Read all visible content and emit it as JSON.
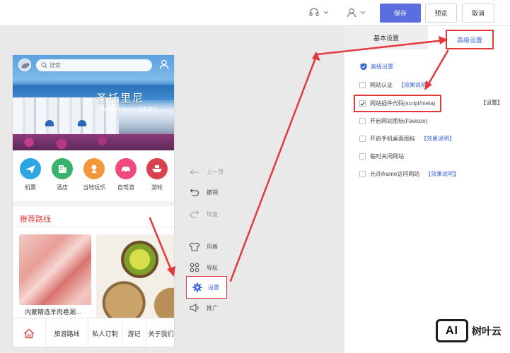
{
  "topbar": {
    "save_label": "保存",
    "preview_label": "预览",
    "cancel_label": "取消",
    "accent": "#5a6ee0"
  },
  "phone": {
    "search_placeholder": "搜索",
    "banner_title": "圣托里尼",
    "banner_subtitle": "Santorini Beach 花季旅行",
    "quick_icons": [
      {
        "label": "机票",
        "icon": "plane-icon",
        "color": "#2da6e6"
      },
      {
        "label": "酒店",
        "icon": "hotel-icon",
        "color": "#39b36b"
      },
      {
        "label": "当地玩乐",
        "icon": "fun-icon",
        "color": "#f4973c"
      },
      {
        "label": "自驾游",
        "icon": "car-icon",
        "color": "#ee4b7d"
      },
      {
        "label": "游轮",
        "icon": "ship-icon",
        "color": "#d9424d"
      }
    ],
    "recommend_title": "推荐路线",
    "card1_caption": "内蒙精选羊肉卷涮...",
    "bottom_nav": [
      "旅游路线",
      "私人订制",
      "游记",
      "关于我们"
    ]
  },
  "tools": {
    "prev": "上一页",
    "undo": "撤销",
    "redo": "恢复",
    "style": "风格",
    "nav": "导航",
    "settings": "设置",
    "promote": "推广"
  },
  "panel": {
    "tab_basic": "基本设置",
    "tab_advanced": "高级设置",
    "section_title": "高级设置",
    "options": [
      {
        "label": "网站认证",
        "checked": false,
        "link": "【效果说明】"
      },
      {
        "label": "网站插件代码(script/meta)",
        "checked": true,
        "link": ""
      },
      {
        "label": "开启网站图标(Favicon)",
        "checked": false,
        "link": ""
      },
      {
        "label": "开启手机桌面图标",
        "checked": false,
        "link": "【效果说明】"
      },
      {
        "label": "临时关闭网站",
        "checked": false,
        "link": ""
      },
      {
        "label": "允许iframe访问网站",
        "checked": false,
        "link": "【效果说明】"
      }
    ],
    "setting_link": "【设置】"
  },
  "watermark": {
    "logo_text": "AI",
    "brand": "树叶云"
  }
}
